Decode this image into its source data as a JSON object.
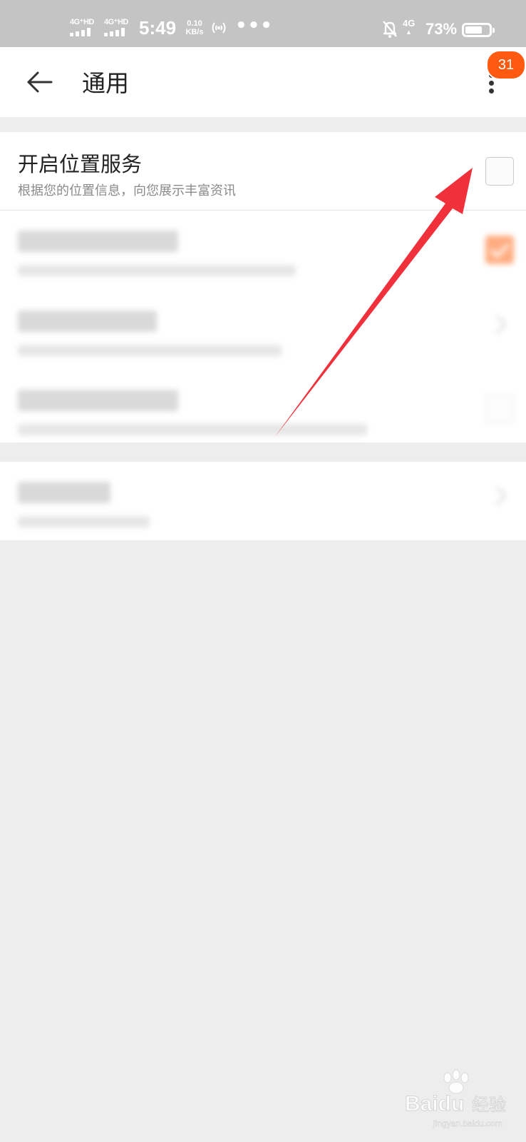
{
  "status_bar": {
    "sim1_network": "4G⁺HD",
    "sim2_network": "4G⁺HD",
    "time": "5:49",
    "speed_value": "0.10",
    "speed_unit": "KB/s",
    "overflow_dots": "•••",
    "data_network": "4G",
    "battery_percent": "73%",
    "battery_level": 0.73,
    "icons": [
      "signal-bars-icon",
      "hotspot-icon",
      "bell-off-icon",
      "data-arrows-icon",
      "battery-icon"
    ]
  },
  "app_bar": {
    "title": "通用",
    "back_icon": "arrow-left-icon",
    "more_icon": "more-vertical-icon",
    "badge_count": "31"
  },
  "settings": {
    "location": {
      "title": "开启位置服务",
      "description": "根据您的位置信息，向您展示丰富资讯",
      "checked": false
    },
    "blurred_rows": [
      {
        "control": "checkbox-checked"
      },
      {
        "control": "chevron-right"
      },
      {
        "control": "checkbox"
      }
    ],
    "clear_cache_row": {
      "control": "chevron-right"
    }
  },
  "colors": {
    "status_bar": "#c4c4c4",
    "accent": "#ff5a0f",
    "annotation_arrow": "#f0303a",
    "background": "#ededed"
  },
  "watermark": {
    "brand": "Baidu",
    "text": "经验",
    "url": "jingyan.baidu.com"
  }
}
